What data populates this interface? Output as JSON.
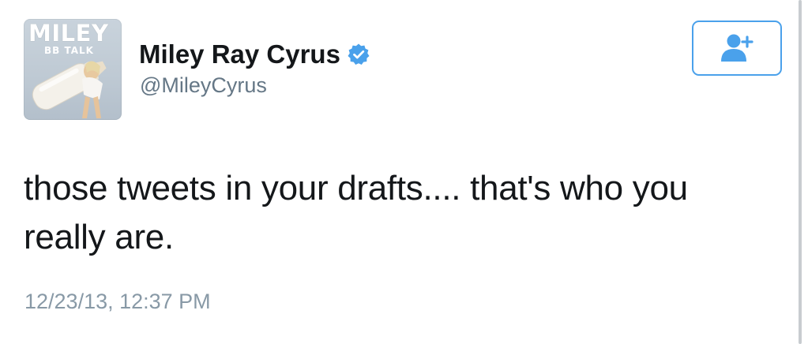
{
  "avatar": {
    "title": "MILEY",
    "subtitle": "BB TALK"
  },
  "user": {
    "display_name": "Miley Ray Cyrus",
    "handle": "@MileyCyrus",
    "verified_icon": "verified-badge-icon"
  },
  "follow_button": {
    "icon": "add-user-icon",
    "accent_color": "#4aa1eb"
  },
  "tweet": {
    "line1": "those tweets in your drafts.... that's who you",
    "line2": "really are.",
    "timestamp": "12/23/13, 12:37 PM"
  },
  "colors": {
    "text": "#14171a",
    "handle": "#657786",
    "timestamp": "#8899a6",
    "verified": "#4aa1eb"
  }
}
